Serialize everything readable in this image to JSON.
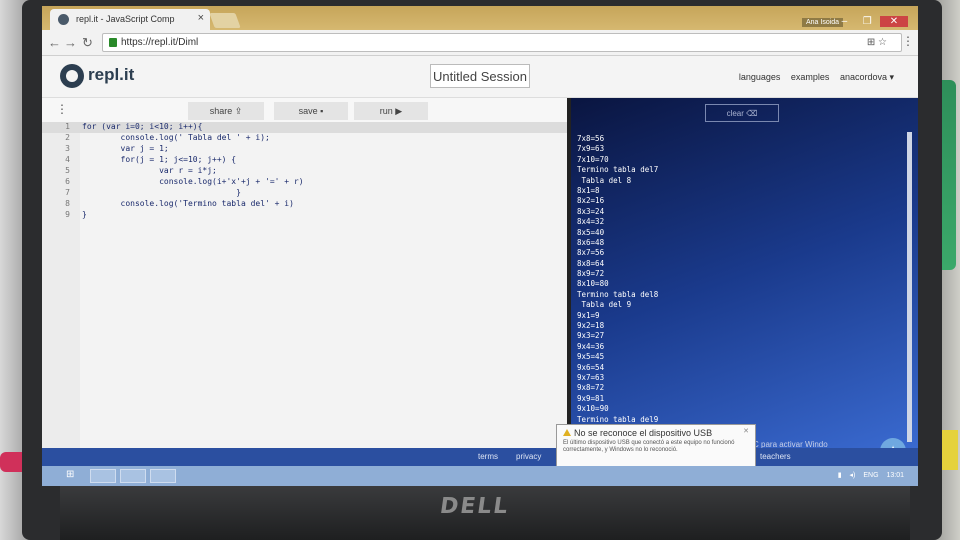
{
  "browser": {
    "tab_title": "repl.it - JavaScript Comp",
    "tab_close": "×",
    "user_name": "Ana Isoida",
    "url": "https://repl.it/Diml",
    "window_controls": [
      "–",
      "❐",
      "✕"
    ],
    "nav": {
      "back": "←",
      "forward": "→",
      "reload": "↻"
    }
  },
  "header": {
    "logo": "repl.it",
    "session_title": "Untitled Session",
    "nav": [
      "languages",
      "examples",
      "anacordova ▾"
    ]
  },
  "editor_toolbar": {
    "share": "share ⇪",
    "save": "save ▪",
    "run": "run ▶"
  },
  "code": [
    {
      "num": "1",
      "text": "for (var i=0; i<10; i++){"
    },
    {
      "num": "2",
      "text": "        console.log(' Tabla del ' + i);"
    },
    {
      "num": "3",
      "text": "        var j = 1;"
    },
    {
      "num": "4",
      "text": "        for(j = 1; j<=10; j++) {"
    },
    {
      "num": "5",
      "text": "                var r = i*j;"
    },
    {
      "num": "6",
      "text": "                console.log(i+'x'+j + '=' + r)"
    },
    {
      "num": "7",
      "text": "                                }"
    },
    {
      "num": "8",
      "text": "        console.log('Termino tabla del' + i)"
    },
    {
      "num": "9",
      "text": "}"
    }
  ],
  "console": {
    "clear_label": "clear ⌫",
    "lines": [
      "7x8=56",
      "7x9=63",
      "7x10=70",
      "Termino tabla del7",
      " Tabla del 8",
      "8x1=8",
      "8x2=16",
      "8x3=24",
      "8x4=32",
      "8x5=40",
      "8x6=48",
      "8x7=56",
      "8x8=64",
      "8x9=72",
      "8x10=80",
      "Termino tabla del8",
      " Tabla del 9",
      "9x1=9",
      "9x2=18",
      "9x3=27",
      "9x4=36",
      "9x5=45",
      "9x6=54",
      "9x7=63",
      "9x8=72",
      "9x9=81",
      "9x10=90",
      "Termino tabla del9"
    ],
    "watermark": "C para activar Windo"
  },
  "footer": {
    "terms": "terms",
    "privacy": "privacy",
    "teachers": "teachers"
  },
  "notification": {
    "title": "No se reconoce el dispositivo USB",
    "body": "El último dispositivo USB que conectó a este equipo no funcionó correctamente, y Windows no lo reconoció."
  },
  "taskbar": {
    "lang": "ENG",
    "time": "13:01"
  },
  "laptop": {
    "brand": "DELL"
  }
}
